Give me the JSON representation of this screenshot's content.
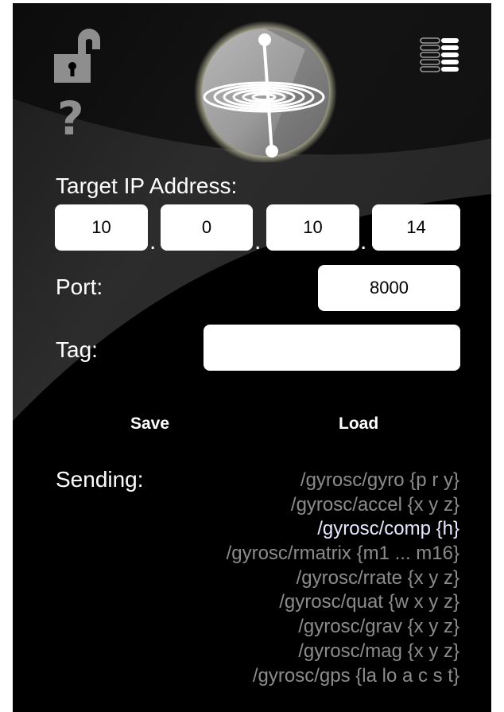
{
  "target_ip": {
    "label": "Target IP Address:",
    "octets": [
      "10",
      "0",
      "10",
      "14"
    ],
    "separator": "."
  },
  "port": {
    "label": "Port:",
    "value": "8000"
  },
  "tag": {
    "label": "Tag:",
    "value": ""
  },
  "actions": {
    "save_label": "Save",
    "load_label": "Load"
  },
  "sending": {
    "label": "Sending:",
    "messages": [
      "/gyrosc/gyro {p r y}",
      "/gyrosc/accel {x y z}",
      "/gyrosc/comp {h}",
      "/gyrosc/rmatrix {m1 ... m16}",
      "/gyrosc/rrate {x y z}",
      "/gyrosc/quat {w x y z}",
      "/gyrosc/grav {x y z}",
      "/gyrosc/mag {x y z}",
      "/gyrosc/gps {la lo a c s t}"
    ],
    "active_index": 2
  },
  "icons": {
    "top_left": "unlocked-padlock-icon",
    "help": "question-mark-icon",
    "logo": "gyroscope-spiral-logo",
    "top_right": "signal-meter-icon"
  },
  "help_glyph": "?",
  "colors": {
    "background": "#000000",
    "sweep": "#3a3a3a",
    "icon_gray": "#8e8e8e",
    "active_message": "#e8e8ff",
    "inactive_message": "#8c8c8c"
  }
}
